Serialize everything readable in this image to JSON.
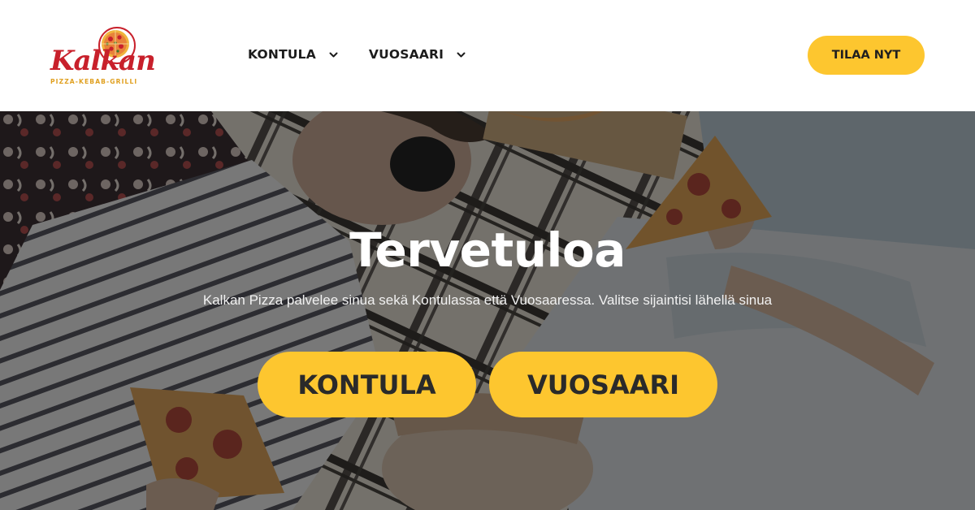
{
  "brand": {
    "name": "Kalkan",
    "tagline": "PIZZA-KEBAB-GRILLI",
    "colors": {
      "logo_red": "#c8202b",
      "accent_yellow": "#fdc62f"
    }
  },
  "nav": {
    "items": [
      {
        "label": "KONTULA",
        "icon": "chevron-down-icon"
      },
      {
        "label": "VUOSAARI",
        "icon": "chevron-down-icon"
      }
    ]
  },
  "header": {
    "order_label": "TILAA NYT"
  },
  "hero": {
    "title": "Tervetuloa",
    "subtitle": "Kalkan Pizza palvelee sinua sekä Kontulassa että Vuosaaressa. Valitse sijaintisi lähellä sinua",
    "buttons": [
      {
        "label": "KONTULA"
      },
      {
        "label": "VUOSAARI"
      }
    ]
  }
}
